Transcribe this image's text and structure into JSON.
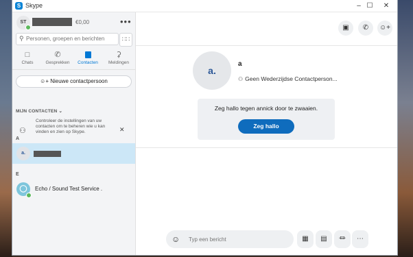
{
  "window": {
    "title": "Skype",
    "app_icon": "S",
    "controls": [
      "minimize-icon",
      "maximize-icon",
      "close-icon"
    ]
  },
  "profile": {
    "initials": "ST",
    "credit": "€0,00",
    "more": "•••"
  },
  "search": {
    "placeholder": "Personen, groepen en berichten"
  },
  "nav": {
    "tabs": [
      {
        "label": "Chats",
        "icon": "chat-icon"
      },
      {
        "label": "Gesprekken",
        "icon": "phone-icon"
      },
      {
        "label": "Contacten",
        "icon": "contacts-icon",
        "active": true
      },
      {
        "label": "Meldingen",
        "icon": "bell-icon"
      }
    ]
  },
  "new_contact_label": "Nieuwe contactpersoon",
  "contacts": {
    "section_label": "MIJN CONTACTEN",
    "info_text": "Controleer de instellingen van uw contacten om te beheren wie u kan vinden en zien op Skype.",
    "groups": [
      {
        "letter": "A",
        "items": [
          {
            "avatar": "a.",
            "selected": true
          }
        ]
      },
      {
        "letter": "E",
        "items": [
          {
            "name": "Echo / Sound Test Service ."
          }
        ]
      }
    ]
  },
  "main": {
    "contact_avatar": "a.",
    "contact_name": "a",
    "contact_status": "Geen Wederzijdse Contactperson...",
    "hello_text": "Zeg hallo tegen annick door te zwaaien.",
    "hello_button": "Zeg hallo",
    "compose_placeholder": "Typ een bericht"
  },
  "colors": {
    "accent": "#0078d4",
    "button": "#0f6cbd",
    "selected_row": "#cce7f7",
    "presence": "#5cb85c"
  }
}
